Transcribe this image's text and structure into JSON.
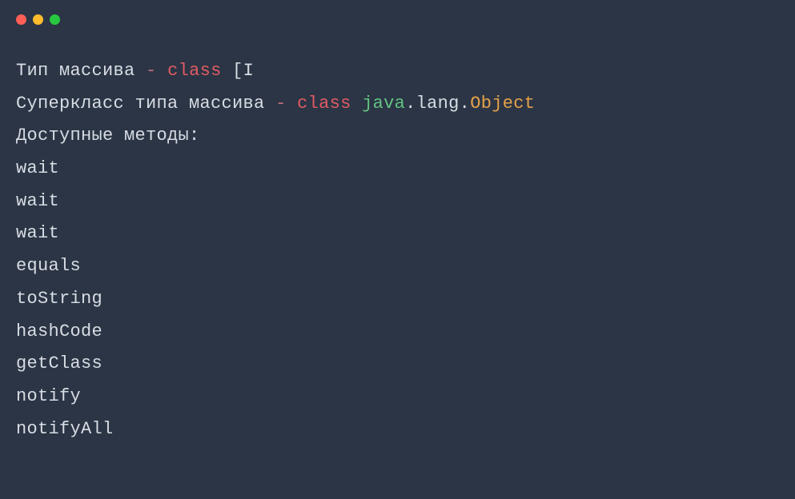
{
  "window": {
    "traffic_lights": {
      "red": "close",
      "yellow": "minimize",
      "green": "zoom"
    }
  },
  "output": {
    "line1": {
      "prefix": "Тип массива ",
      "dash": "-",
      "space": " ",
      "keyword": "class",
      "suffix": " [I"
    },
    "line2": {
      "prefix": "Суперкласс типа массива ",
      "dash": "-",
      "space": " ",
      "keyword": "class",
      "space2": " ",
      "package": "java",
      "dot1": ".",
      "subpackage": "lang",
      "dot2": ".",
      "classname": "Object"
    },
    "line3": "Доступные методы:",
    "methods": [
      "wait",
      "wait",
      "wait",
      "equals",
      "toString",
      "hashCode",
      "getClass",
      "notify",
      "notifyAll"
    ]
  }
}
